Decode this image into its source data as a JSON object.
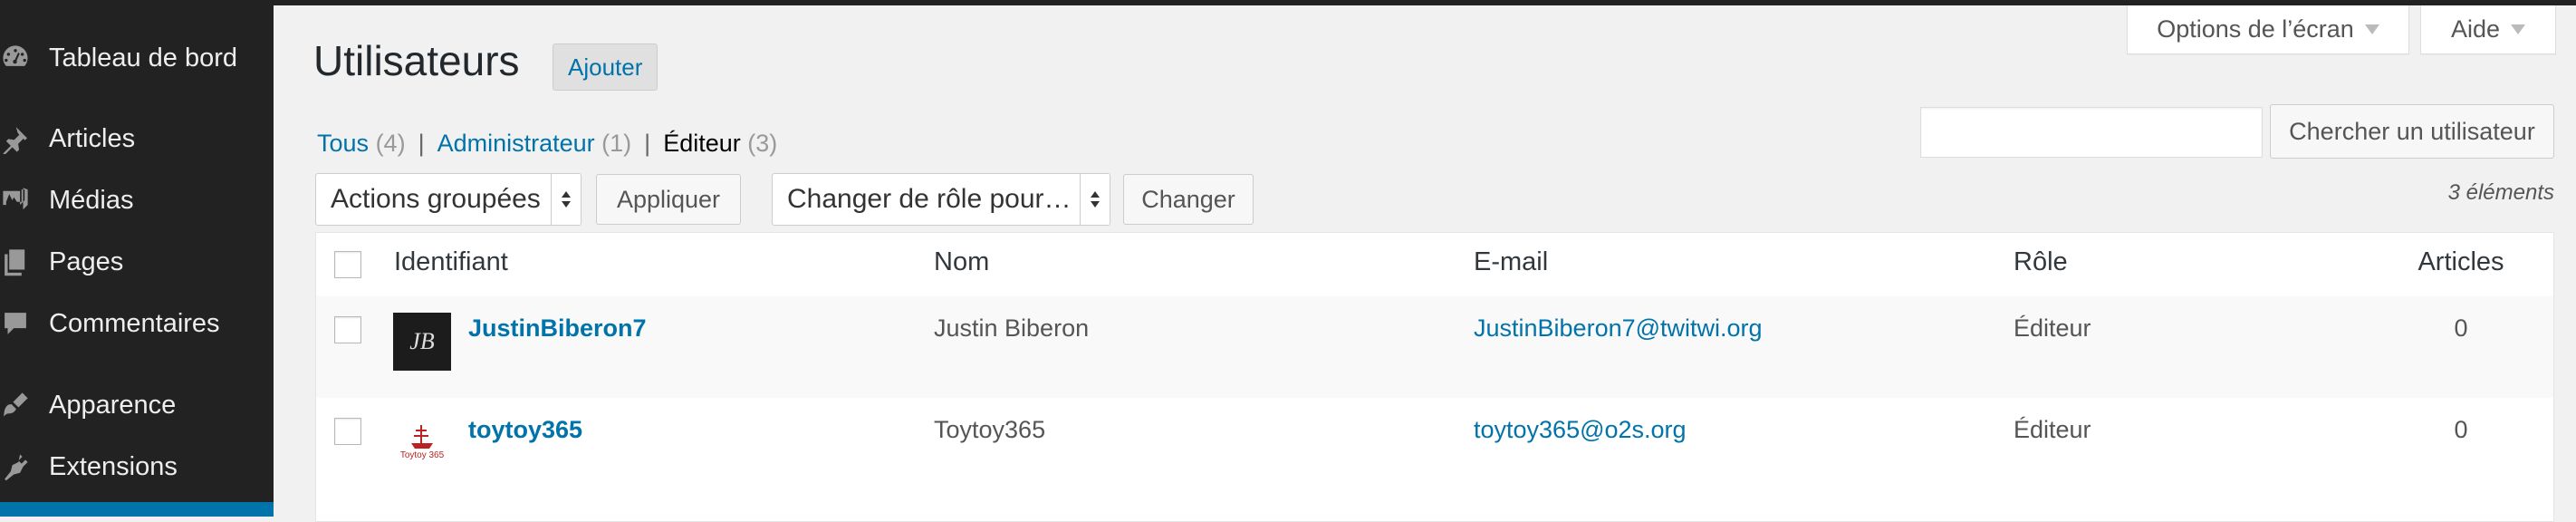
{
  "sidebar": {
    "items": [
      {
        "label": "Tableau de bord",
        "icon": "dashboard-icon"
      },
      {
        "label": "Articles",
        "icon": "pushpin-icon"
      },
      {
        "label": "Médias",
        "icon": "media-icon"
      },
      {
        "label": "Pages",
        "icon": "pages-icon"
      },
      {
        "label": "Commentaires",
        "icon": "comments-icon"
      },
      {
        "label": "Apparence",
        "icon": "appearance-icon"
      },
      {
        "label": "Extensions",
        "icon": "plugins-icon"
      }
    ],
    "active_color": "#0073aa"
  },
  "screen_options": {
    "label": "Options de l’écran"
  },
  "help": {
    "label": "Aide"
  },
  "header": {
    "title": "Utilisateurs",
    "add_label": "Ajouter"
  },
  "filters": [
    {
      "label": "Tous",
      "count": "(4)",
      "current": false
    },
    {
      "label": "Administrateur",
      "count": "(1)",
      "current": false
    },
    {
      "label": "Éditeur",
      "count": "(3)",
      "current": true
    }
  ],
  "search": {
    "placeholder": "",
    "button_label": "Chercher un utilisateur"
  },
  "tablenav": {
    "bulk_actions": "Actions groupées",
    "apply_label": "Appliquer",
    "change_role": "Changer de rôle pour…",
    "change_label": "Changer",
    "items_count": "3 éléments"
  },
  "table": {
    "columns": {
      "username": "Identifiant",
      "name": "Nom",
      "email": "E-mail",
      "role": "Rôle",
      "posts": "Articles"
    },
    "rows": [
      {
        "username": "JustinBiberon7",
        "name": "Justin Biberon",
        "email": "JustinBiberon7@twitwi.org",
        "role": "Éditeur",
        "posts": "0",
        "avatar_text": "JB"
      },
      {
        "username": "toytoy365",
        "name": "Toytoy365",
        "email": "toytoy365@o2s.org",
        "role": "Éditeur",
        "posts": "0",
        "avatar_text": "Toytoy 365"
      }
    ]
  },
  "colors": {
    "link": "#0073aa",
    "sidebar_bg": "#222222",
    "page_bg": "#f1f1f1"
  }
}
